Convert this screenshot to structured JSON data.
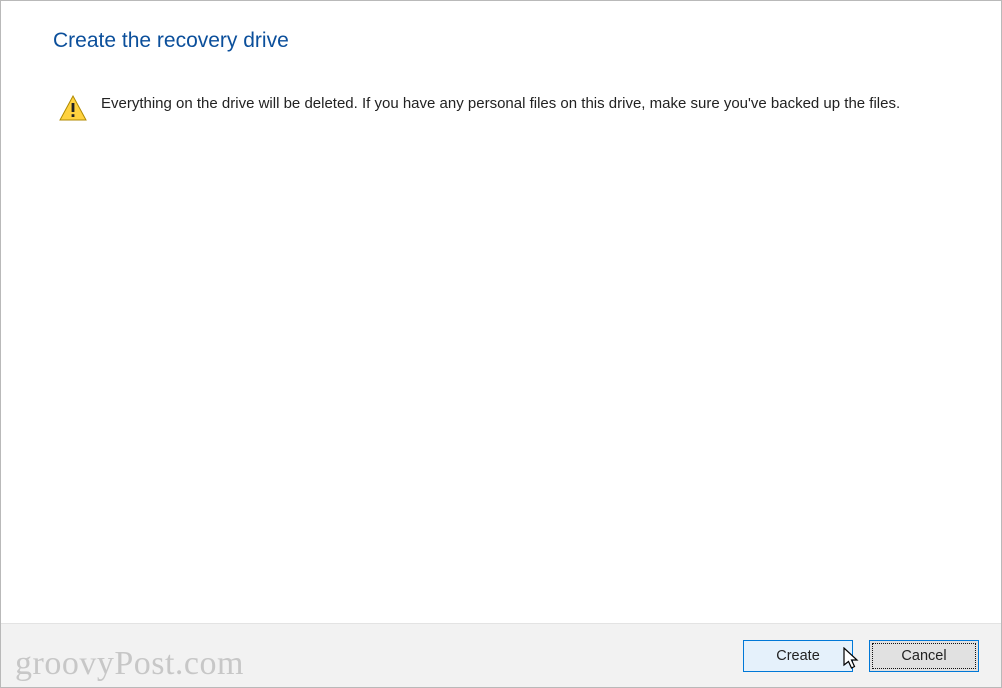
{
  "header": {
    "title": "Create the recovery drive"
  },
  "warning": {
    "message": "Everything on the drive will be deleted. If you have any personal files on this drive, make sure you've backed up the files."
  },
  "footer": {
    "create_label": "Create",
    "cancel_label": "Cancel",
    "watermark": "groovyPost.com"
  }
}
